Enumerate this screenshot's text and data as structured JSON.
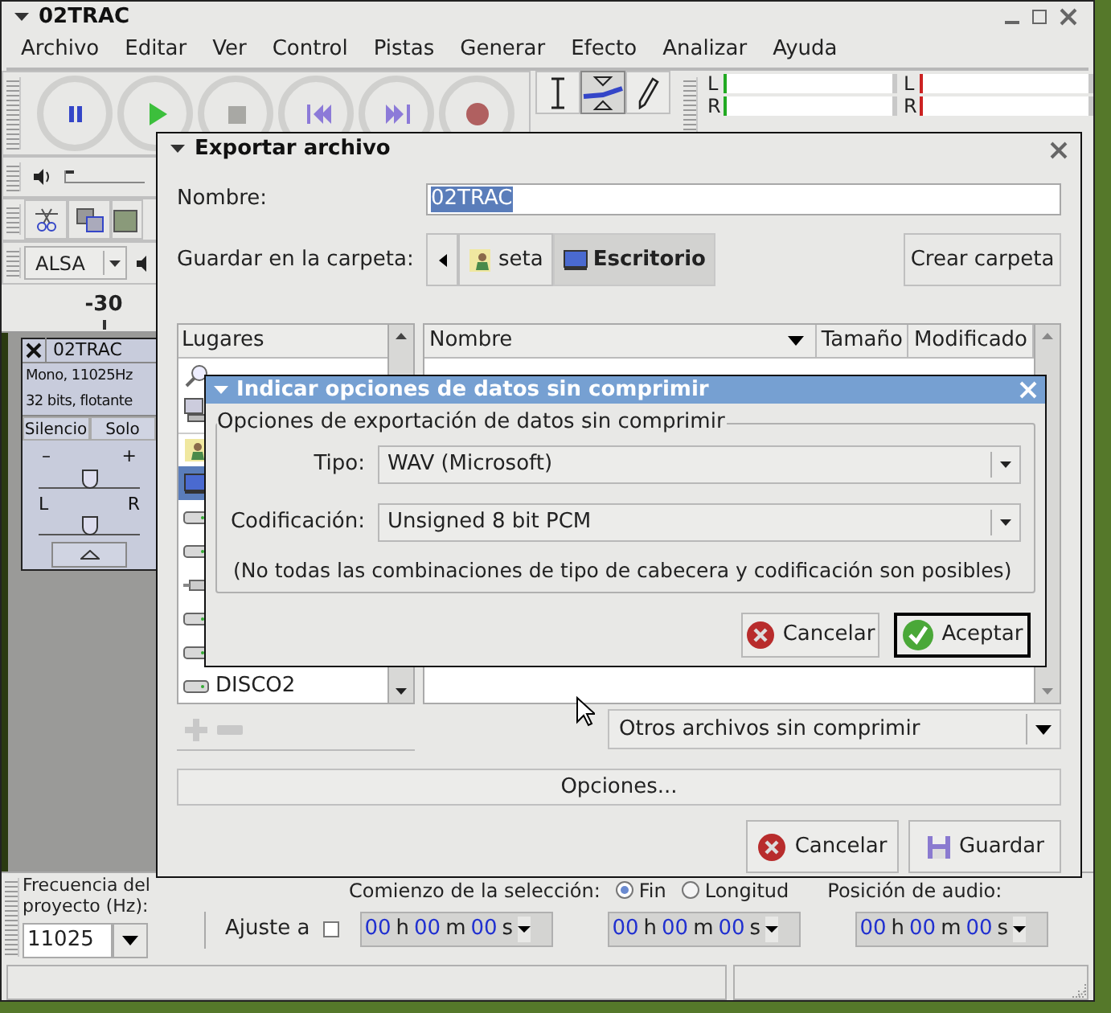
{
  "main_window": {
    "title": "02TRAC",
    "menu": [
      "Archivo",
      "Editar",
      "Ver",
      "Control",
      "Pistas",
      "Generar",
      "Efecto",
      "Analizar",
      "Ayuda"
    ],
    "transport": [
      {
        "kind": "pause"
      },
      {
        "kind": "play"
      },
      {
        "kind": "stop"
      },
      {
        "kind": "skip-start"
      },
      {
        "kind": "skip-end"
      },
      {
        "kind": "record"
      }
    ],
    "tools": [
      {
        "kind": "select",
        "selected": false
      },
      {
        "kind": "envelope",
        "selected": true
      },
      {
        "kind": "draw",
        "selected": false
      }
    ],
    "meters": [
      {
        "channels": [
          "L",
          "R"
        ],
        "color": "#22aa22"
      },
      {
        "channels": [
          "L",
          "R"
        ],
        "color": "#cc2222"
      }
    ],
    "volume": {
      "level": 0
    },
    "audio_host": "ALSA",
    "ruler_label": "-30",
    "track": {
      "name": "02TRAC",
      "info": [
        "Mono, 11025Hz",
        "32 bits, flotante"
      ],
      "buttons": [
        "Silencio",
        "Solo"
      ],
      "gain_labels": [
        "–",
        "+"
      ],
      "gain": {
        "level": 0.5
      },
      "pan_labels": [
        "L",
        "R"
      ],
      "pan": {
        "level": 0.5
      }
    },
    "bottom_bar": {
      "rate_label": "Frecuencia del proyecto (Hz):",
      "rate": "11025",
      "snap_label": "Ajuste a",
      "snap_checked": false,
      "selection_label": "Comienzo de la selección:",
      "end_modes": [
        {
          "label": "Fin",
          "selected": true
        },
        {
          "label": "Longitud",
          "selected": false
        }
      ],
      "position_label": "Posición de audio:",
      "time_fields": [
        {
          "parts": [
            {
              "value": "00",
              "unit": "h"
            },
            {
              "value": "00",
              "unit": "m"
            },
            {
              "value": "00",
              "unit": "s"
            }
          ]
        },
        {
          "parts": [
            {
              "value": "00",
              "unit": "h"
            },
            {
              "value": "00",
              "unit": "m"
            },
            {
              "value": "00",
              "unit": "s"
            }
          ]
        },
        {
          "parts": [
            {
              "value": "00",
              "unit": "h"
            },
            {
              "value": "00",
              "unit": "m"
            },
            {
              "value": "00",
              "unit": "s"
            }
          ]
        }
      ]
    }
  },
  "export_dialog": {
    "title": "Exportar archivo",
    "name_label": "Nombre:",
    "name_value": "02TRAC",
    "folder_label": "Guardar en la carpeta:",
    "path": [
      {
        "label": "seta",
        "kind": "home",
        "selected": false
      },
      {
        "label": "Escritorio",
        "kind": "desktop",
        "selected": true
      }
    ],
    "create_folder": "Crear carpeta",
    "places_header": "Lugares",
    "places": [
      {
        "kind": "search",
        "selected": false
      },
      {
        "kind": "computer",
        "selected": false
      },
      {
        "kind": "home",
        "selected": false
      },
      {
        "kind": "desktop",
        "selected": true
      },
      {
        "kind": "drive",
        "selected": false
      },
      {
        "kind": "drive",
        "selected": false
      },
      {
        "kind": "usb",
        "selected": false
      },
      {
        "kind": "drive",
        "selected": false
      },
      {
        "kind": "drive",
        "selected": false
      },
      {
        "kind": "drive",
        "selected": false,
        "label": "DISCO2"
      }
    ],
    "file_columns": [
      "Nombre",
      "Tamaño",
      "Modificado"
    ],
    "filter": "Otros archivos sin comprimir",
    "options_button": "Opciones...",
    "buttons": [
      {
        "label": "Cancelar",
        "kind": "cancel"
      },
      {
        "label": "Guardar",
        "kind": "save"
      }
    ]
  },
  "options_dialog": {
    "title": "Indicar opciones de datos sin comprimir",
    "group_title": "Opciones de exportación de datos sin comprimir",
    "fields": [
      {
        "label": "Tipo:",
        "value": "WAV (Microsoft)"
      },
      {
        "label": "Codificación:",
        "value": "Unsigned 8 bit PCM"
      }
    ],
    "note": "(No todas las combinaciones de tipo de cabecera y codificación son posibles)",
    "buttons": [
      {
        "label": "Cancelar",
        "kind": "cancel",
        "default": false
      },
      {
        "label": "Aceptar",
        "kind": "ok",
        "default": true
      }
    ]
  }
}
